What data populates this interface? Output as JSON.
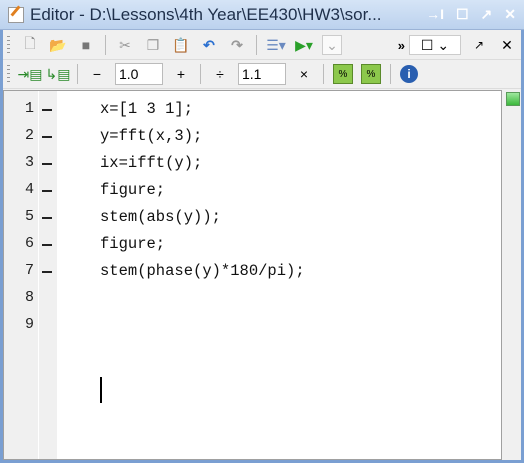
{
  "title": "Editor - D:\\Lessons\\4th Year\\EE430\\HW3\\sor...",
  "toolbar2": {
    "decrement": "−",
    "cell_value_1": "1.0",
    "increment": "+",
    "divide": "÷",
    "cell_value_2": "1.1",
    "multiply": "×"
  },
  "lines": [
    {
      "n": "1",
      "code": "x=[1 3 1];"
    },
    {
      "n": "2",
      "code": "y=fft(x,3);"
    },
    {
      "n": "3",
      "code": "ix=ifft(y);"
    },
    {
      "n": "4",
      "code": "figure;"
    },
    {
      "n": "5",
      "code": "stem(abs(y));"
    },
    {
      "n": "6",
      "code": "figure;"
    },
    {
      "n": "7",
      "code": "stem(phase(y)*180/pi);"
    },
    {
      "n": "8",
      "code": ""
    },
    {
      "n": "9",
      "code": ""
    }
  ]
}
